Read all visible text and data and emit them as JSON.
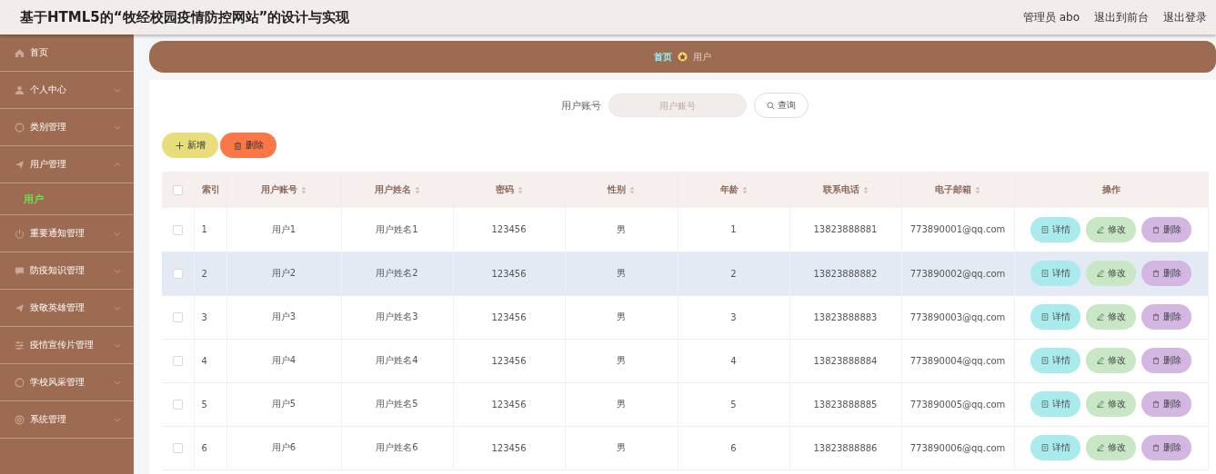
{
  "header": {
    "title": "基于HTML5的“牧经校园疫情防控网站”的设计与实现",
    "user": "管理员 abo",
    "links": [
      "退出到前台",
      "退出登录"
    ]
  },
  "sidebar": {
    "items": [
      {
        "label": "首页",
        "has_arrow": false
      },
      {
        "label": "个人中心",
        "expanded": false,
        "has_arrow": true
      },
      {
        "label": "类别管理",
        "expanded": false,
        "has_arrow": true
      },
      {
        "label": "用户管理",
        "expanded": true,
        "has_arrow": true,
        "children": [
          {
            "label": "用户",
            "selected": true
          }
        ]
      },
      {
        "label": "重要通知管理",
        "expanded": false,
        "has_arrow": true
      },
      {
        "label": "防疫知识管理",
        "expanded": false,
        "has_arrow": true
      },
      {
        "label": "致敬英雄管理",
        "expanded": false,
        "has_arrow": true
      },
      {
        "label": "疫情宣传片管理",
        "expanded": false,
        "has_arrow": true
      },
      {
        "label": "学校风采管理",
        "expanded": false,
        "has_arrow": true
      },
      {
        "label": "系统管理",
        "expanded": false,
        "has_arrow": true
      }
    ]
  },
  "breadcrumb": [
    "首页",
    "用户"
  ],
  "search": {
    "label": "用户账号",
    "placeholder": "用户账号",
    "button": "查询"
  },
  "toolbar": [
    {
      "kind": "add",
      "label": "新增"
    },
    {
      "kind": "delete",
      "label": "删除"
    }
  ],
  "table": {
    "select_all": false,
    "columns": [
      {
        "label": "索引",
        "sortable": false
      },
      {
        "label": "用户账号",
        "sortable": true
      },
      {
        "label": "用户姓名",
        "sortable": true
      },
      {
        "label": "密码",
        "sortable": true
      },
      {
        "label": "性别",
        "sortable": true
      },
      {
        "label": "年龄",
        "sortable": true
      },
      {
        "label": "联系电话",
        "sortable": true
      },
      {
        "label": "电子邮箱",
        "sortable": true
      },
      {
        "label": "操作",
        "sortable": false
      }
    ],
    "rows": [
      {
        "checked": false,
        "highlighted": false,
        "cells": [
          "1",
          "用户1",
          "用户姓名1",
          "123456",
          "男",
          "1",
          "13823888881",
          "773890001@qq.com"
        ],
        "actions": [
          {
            "kind": "detail",
            "label": "详情"
          },
          {
            "kind": "edit",
            "label": "修改"
          },
          {
            "kind": "delete",
            "label": "删除"
          }
        ]
      },
      {
        "checked": false,
        "highlighted": true,
        "cells": [
          "2",
          "用户2",
          "用户姓名2",
          "123456",
          "男",
          "2",
          "13823888882",
          "773890002@qq.com"
        ],
        "actions": [
          {
            "kind": "detail",
            "label": "详情"
          },
          {
            "kind": "edit",
            "label": "修改"
          },
          {
            "kind": "delete",
            "label": "删除"
          }
        ]
      },
      {
        "checked": false,
        "highlighted": false,
        "cells": [
          "3",
          "用户3",
          "用户姓名3",
          "123456",
          "男",
          "3",
          "13823888883",
          "773890003@qq.com"
        ],
        "actions": [
          {
            "kind": "detail",
            "label": "详情"
          },
          {
            "kind": "edit",
            "label": "修改"
          },
          {
            "kind": "delete",
            "label": "删除"
          }
        ]
      },
      {
        "checked": false,
        "highlighted": false,
        "cells": [
          "4",
          "用户4",
          "用户姓名4",
          "123456",
          "男",
          "4",
          "13823888884",
          "773890004@qq.com"
        ],
        "actions": [
          {
            "kind": "detail",
            "label": "详情"
          },
          {
            "kind": "edit",
            "label": "修改"
          },
          {
            "kind": "delete",
            "label": "删除"
          }
        ]
      },
      {
        "checked": false,
        "highlighted": false,
        "cells": [
          "5",
          "用户5",
          "用户姓名5",
          "123456",
          "男",
          "5",
          "13823888885",
          "773890005@qq.com"
        ],
        "actions": [
          {
            "kind": "detail",
            "label": "详情"
          },
          {
            "kind": "edit",
            "label": "修改"
          },
          {
            "kind": "delete",
            "label": "删除"
          }
        ]
      },
      {
        "checked": false,
        "highlighted": false,
        "cells": [
          "6",
          "用户6",
          "用户姓名6",
          "123456",
          "男",
          "6",
          "13823888886",
          "773890006@qq.com"
        ],
        "actions": [
          {
            "kind": "detail",
            "label": "详情"
          },
          {
            "kind": "edit",
            "label": "修改"
          },
          {
            "kind": "delete",
            "label": "删除"
          }
        ]
      }
    ]
  }
}
